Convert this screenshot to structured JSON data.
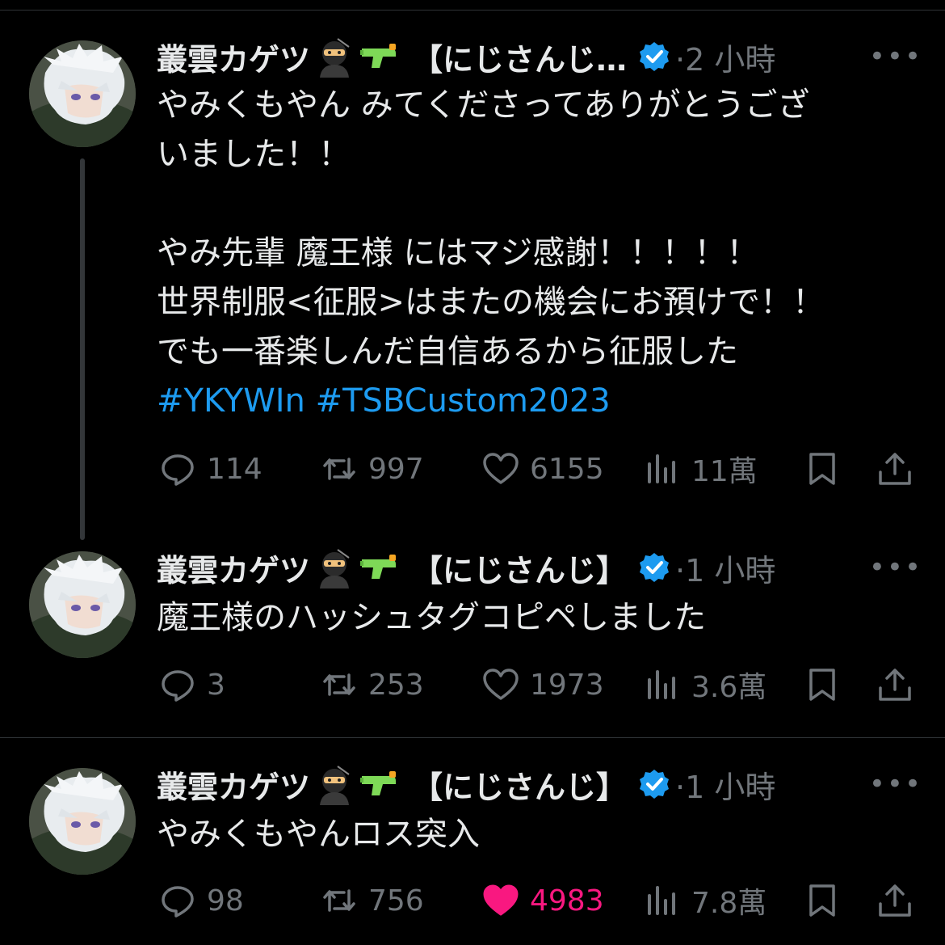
{
  "tweets": [
    {
      "author": "叢雲カゲツ",
      "affiliation": "【にじさんじ…",
      "time": "2 小時",
      "more": "•••",
      "lines": [
        "やみくもやん みてくださってありがとうござ",
        "いました！！",
        "",
        "やみ先輩 魔王様 にはマジ感謝！！！！！",
        "世界制服<征服>はまたの機会にお預けで！！",
        "でも一番楽しんだ自信あるから征服した"
      ],
      "hashtags": "#YKYWIn #TSBCustom2023",
      "replies": "114",
      "retweets": "997",
      "likes": "6155",
      "views": "11萬",
      "liked": false
    },
    {
      "author": "叢雲カゲツ",
      "affiliation": "【にじさんじ】",
      "time": "1 小時",
      "more": "•••",
      "lines": [
        "魔王様のハッシュタグコピペしました"
      ],
      "replies": "3",
      "retweets": "253",
      "likes": "1973",
      "views": "3.6萬",
      "liked": false
    },
    {
      "author": "叢雲カゲツ",
      "affiliation": "【にじさんじ】",
      "time": "1 小時",
      "more": "•••",
      "lines": [
        "やみくもやんロス突入"
      ],
      "replies": "98",
      "retweets": "756",
      "likes": "4983",
      "views": "7.8萬",
      "liked": true
    }
  ],
  "icons": {
    "emoji1": "ninja-emoji",
    "emoji2": "water-pistol-emoji",
    "verified": "verified-badge-icon",
    "reply": "reply-icon",
    "retweet": "retweet-icon",
    "like": "heart-icon",
    "views": "views-icon",
    "bookmark": "bookmark-icon",
    "share": "share-icon"
  },
  "colors": {
    "background": "#000000",
    "text": "#e7e9ea",
    "muted": "#71767b",
    "link": "#1d9bf0",
    "like": "#f91880",
    "verified": "#1d9bf0"
  }
}
